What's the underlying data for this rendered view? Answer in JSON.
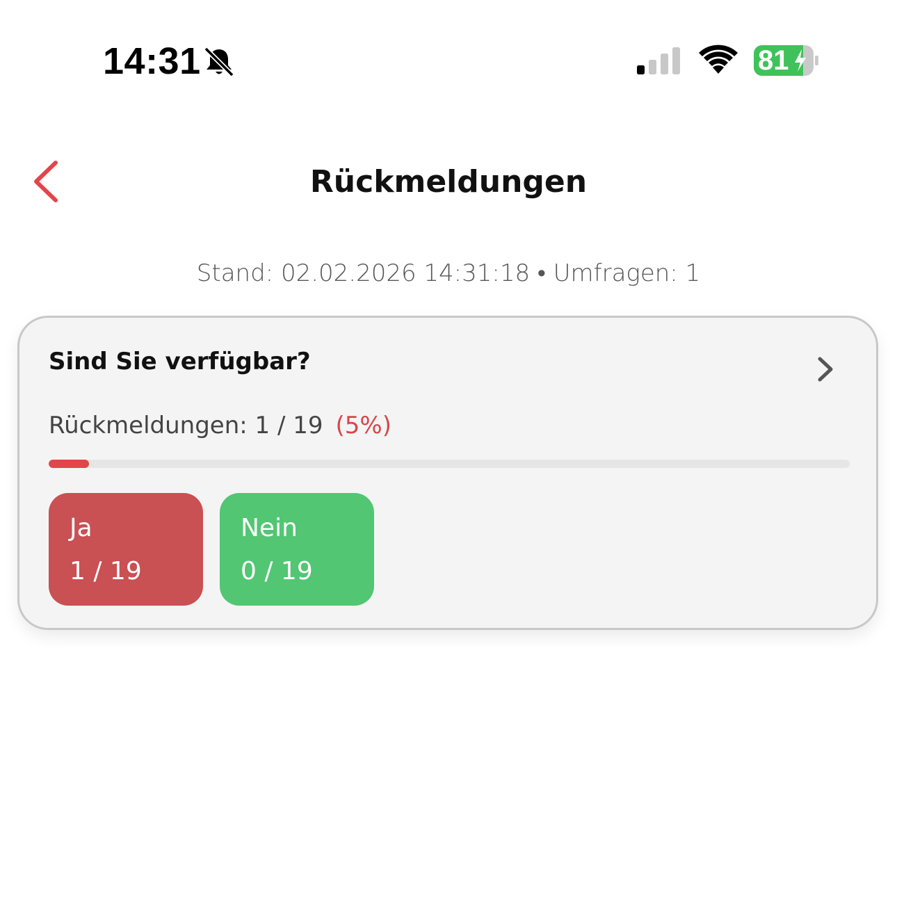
{
  "status_bar": {
    "time": "14:31",
    "battery_percent": "81",
    "battery_level": 0.81,
    "icons": [
      "bell-slash-icon",
      "cellular-signal-icon",
      "wifi-icon",
      "battery-charging-icon"
    ],
    "signal_bars_active": 1,
    "signal_bars_total": 4,
    "battery_color": "#3fc25a"
  },
  "header": {
    "back_icon": "chevron-left-icon",
    "title": "Rückmeldungen",
    "accent_color": "#e3454a"
  },
  "meta": {
    "text": "Stand: 02.02.2026 14:31:18 • Umfragen: 1"
  },
  "poll": {
    "question": "Sind Sie verfügbar?",
    "chevron_icon": "chevron-right-icon",
    "responses_text": "Rückmeldungen: 1 / 19",
    "responses_percent_text": "(5%)",
    "progress": 0.05,
    "progress_color": "#e3454a",
    "options": [
      {
        "label": "Ja",
        "count": "1 / 19",
        "color": "#c95053"
      },
      {
        "label": "Nein",
        "count": "0 / 19",
        "color": "#52c673"
      }
    ]
  }
}
